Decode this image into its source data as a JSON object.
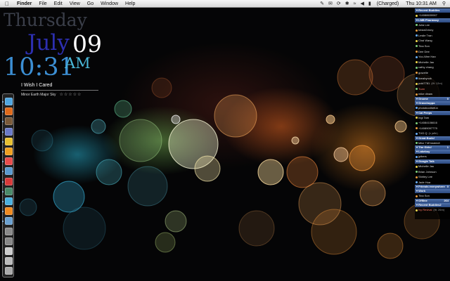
{
  "menubar": {
    "apple_icon": "apple-icon",
    "app": "Finder",
    "items": [
      "File",
      "Edit",
      "View",
      "Go",
      "Window",
      "Help"
    ],
    "status_icons": [
      "script-icon",
      "mail-icon",
      "sync-icon",
      "bluetooth-icon",
      "wifi-icon",
      "volume-icon"
    ],
    "battery": "(Charged)",
    "clock": "Thu 10:31 AM",
    "spotlight_icon": "spotlight-icon"
  },
  "clock_widget": {
    "day": "Thursday",
    "month": "July",
    "date": "09",
    "time": "10:31",
    "ampm": "AM",
    "colors": {
      "day": "#3b3f4a",
      "month": "#2d2fb0",
      "date": "#ffffff",
      "time": "#3c8fd4",
      "ampm": "#4ab8d8"
    }
  },
  "now_playing": {
    "title": "I Wish I Cared",
    "subtitle": "Minor Earth Major Sky",
    "rating_stars": "☆☆☆☆☆",
    "rating": 0
  },
  "dock": {
    "items": [
      {
        "name": "finder-icon",
        "color": "#4fa6e0"
      },
      {
        "name": "firefox-icon",
        "color": "#e06a1a"
      },
      {
        "name": "address-book-icon",
        "color": "#7a5a3a"
      },
      {
        "name": "itunes-icon",
        "color": "#6a7ac8"
      },
      {
        "name": "stickies-icon",
        "color": "#e8c030"
      },
      {
        "name": "pages-icon",
        "color": "#f0a020"
      },
      {
        "name": "photo-icon",
        "color": "#e84c4c"
      },
      {
        "name": "mail-icon",
        "color": "#5a9ad0"
      },
      {
        "name": "ical-icon",
        "color": "#d83a3a"
      },
      {
        "name": "preview-icon",
        "color": "#4a8a6a"
      },
      {
        "name": "adium-icon",
        "color": "#4ab0e0"
      },
      {
        "name": "vlc-icon",
        "color": "#f08a20"
      },
      {
        "name": "terminal-icon",
        "color": "#6aa0d0"
      },
      {
        "name": "system-preferences-icon",
        "color": "#8a8a8a"
      },
      {
        "name": "grid-icon",
        "color": "#888888"
      },
      {
        "name": "documents-icon",
        "color": "#cccccc"
      },
      {
        "name": "downloads-icon",
        "color": "#bbbbbb"
      },
      {
        "name": "trash-icon",
        "color": "#aaaaaa"
      }
    ]
  },
  "buddy_list": {
    "groups": [
      {
        "title": "Recent Buddies",
        "count": "",
        "rows": [
          {
            "name": "+14088630067",
            "status": "",
            "hl": false
          }
        ]
      },
      {
        "title": "LMB Pharmacy",
        "count": "",
        "rows": [
          {
            "name": "Julia Lee",
            "status": "",
            "hl": false
          },
          {
            "name": "kristaGrinny",
            "status": "",
            "hl": false
          },
          {
            "name": "Leslie Tran",
            "status": "",
            "hl": false
          },
          {
            "name": "Chai Wang",
            "status": "",
            "hl": false
          },
          {
            "name": "Tina Son",
            "status": "",
            "hl": false
          },
          {
            "name": "Dee Dee",
            "status": "",
            "hl": false
          },
          {
            "name": "Yoo-Wee Han",
            "status": "",
            "hl": false
          },
          {
            "name": "Michelle Jau",
            "status": "",
            "hl": false
          },
          {
            "name": "cathy chang",
            "status": "",
            "hl": false
          },
          {
            "name": "grazelle",
            "status": "",
            "hl": false
          },
          {
            "name": "lizeabynok",
            "status": "",
            "hl": false
          },
          {
            "name": "poki7781",
            "status": "(lft: 12m)",
            "hl": false
          },
          {
            "name": "Tuan",
            "status": "",
            "hl": true
          },
          {
            "name": "mike dinaw",
            "status": "",
            "hl": false
          }
        ]
      },
      {
        "title": "Gnome",
        "count": "0",
        "rows": []
      },
      {
        "title": "Grasshoppa",
        "count": "",
        "rows": [
          {
            "name": "photoboothefun",
            "status": "",
            "hl": false
          }
        ]
      },
      {
        "title": "Cal Peeps",
        "count": "",
        "rows": [
          {
            "name": "Ingi Tam",
            "status": "",
            "hl": false
          },
          {
            "name": "+14084106616",
            "status": "",
            "hl": false
          },
          {
            "name": "+14089097779",
            "status": "",
            "hl": false
          },
          {
            "name": "TVG Q",
            "status": "(k jaffe)",
            "hl": false
          }
        ]
      },
      {
        "title": "Great Buds!",
        "count": "",
        "rows": [
          {
            "name": "Mike T4Einstein8",
            "status": "",
            "hl": false
          }
        ]
      },
      {
        "title": "The Girls!",
        "count": "1",
        "rows": []
      },
      {
        "title": "Lakeboy",
        "count": "",
        "rows": [
          {
            "name": "jpibers",
            "status": "",
            "hl": false
          }
        ]
      },
      {
        "title": "Google Talk",
        "count": "",
        "rows": [
          {
            "name": "Michelle Jau",
            "status": "",
            "hl": false
          },
          {
            "name": "Brian Johnson",
            "status": "",
            "hl": false
          },
          {
            "name": "Shirley Lee",
            "status": "",
            "hl": false
          },
          {
            "name": "Jade Hua",
            "status": "",
            "hl": false
          }
        ]
      },
      {
        "title": "Friends everywhere",
        "count": "0",
        "rows": []
      },
      {
        "title": "Work",
        "count": "",
        "rows": [
          {
            "name": "Tina Son",
            "status": "",
            "hl": false
          }
        ]
      },
      {
        "title": "Offline",
        "count": "264",
        "rows": []
      },
      {
        "title": "Recent Buddies2",
        "count": "",
        "rows": [
          {
            "name": "Ivy Revival",
            "status": "(lft: 26m)",
            "hl": true
          }
        ]
      }
    ]
  }
}
